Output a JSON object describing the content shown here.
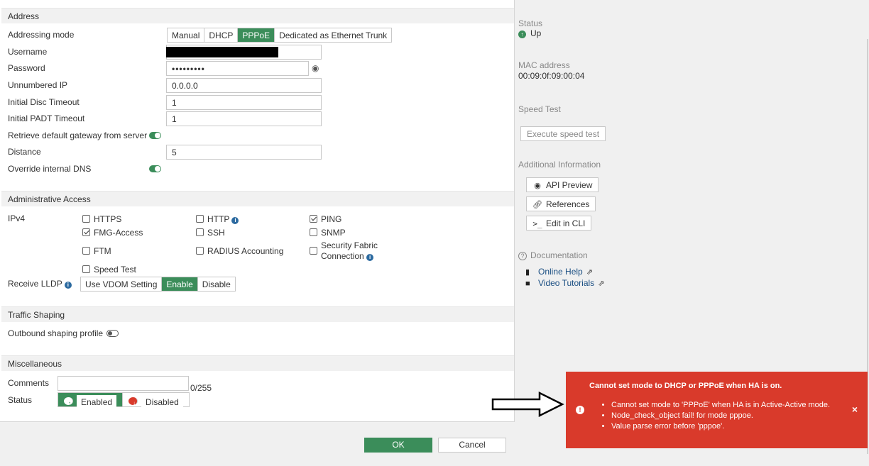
{
  "address": {
    "section_title": "Address",
    "addressing_mode": {
      "label": "Addressing mode",
      "options": [
        "Manual",
        "DHCP",
        "PPPoE",
        "Dedicated as Ethernet Trunk"
      ],
      "selected": "PPPoE"
    },
    "username": {
      "label": "Username"
    },
    "password": {
      "label": "Password",
      "value": "•••••••••"
    },
    "unnumbered_ip": {
      "label": "Unnumbered IP",
      "value": "0.0.0.0"
    },
    "initial_disc_timeout": {
      "label": "Initial Disc Timeout",
      "value": "1"
    },
    "initial_padt_timeout": {
      "label": "Initial PADT Timeout",
      "value": "1"
    },
    "retrieve_gateway": {
      "label": "Retrieve default gateway from server",
      "enabled": true
    },
    "distance": {
      "label": "Distance",
      "value": "5"
    },
    "override_dns": {
      "label": "Override internal DNS",
      "enabled": true
    }
  },
  "admin_access": {
    "section_title": "Administrative Access",
    "ipv4_label": "IPv4",
    "options": [
      {
        "label": "HTTPS",
        "checked": false
      },
      {
        "label": "HTTP",
        "checked": false
      },
      {
        "label": "PING",
        "checked": true
      },
      {
        "label": "FMG-Access",
        "checked": true
      },
      {
        "label": "SSH",
        "checked": false
      },
      {
        "label": "SNMP",
        "checked": false
      },
      {
        "label": "FTM",
        "checked": false
      },
      {
        "label": "RADIUS Accounting",
        "checked": false
      },
      {
        "label": "Security Fabric",
        "label2": "Connection",
        "checked": false
      },
      {
        "label": "Speed Test",
        "checked": false
      }
    ],
    "receive_lldp": {
      "label": "Receive LLDP",
      "options": [
        "Use VDOM Setting",
        "Enable",
        "Disable"
      ],
      "selected": "Enable"
    }
  },
  "traffic_shaping": {
    "section_title": "Traffic Shaping",
    "outbound_label": "Outbound shaping profile",
    "enabled": false
  },
  "misc": {
    "section_title": "Miscellaneous",
    "comments_label": "Comments",
    "comments_count": "0/255",
    "status_label": "Status",
    "enabled_label": "Enabled",
    "disabled_label": "Disabled"
  },
  "right": {
    "status_label": "Status",
    "status_value": "Up",
    "mac_label": "MAC address",
    "mac_value": "00:09:0f:09:00:04",
    "speed_test_label": "Speed Test",
    "speed_test_button": "Execute speed test",
    "additional_info_label": "Additional Information",
    "api_preview": "API Preview",
    "references": "References",
    "edit_cli": "Edit in CLI",
    "documentation_label": "Documentation",
    "online_help": "Online Help",
    "video_tutorials": "Video Tutorials"
  },
  "buttons": {
    "ok": "OK",
    "cancel": "Cancel"
  },
  "error_toast": {
    "title": "Cannot set mode to DHCP or PPPoE when HA is on.",
    "messages": [
      "Cannot set mode to 'PPPoE' when HA is in Active-Active mode.",
      "Node_check_object fail! for mode pppoe.",
      "Value parse error before 'pppoe'."
    ],
    "close": "×"
  },
  "colors": {
    "accent_green": "#3b8d5a",
    "error_red": "#d93a2b",
    "link_blue": "#1a4e82"
  }
}
